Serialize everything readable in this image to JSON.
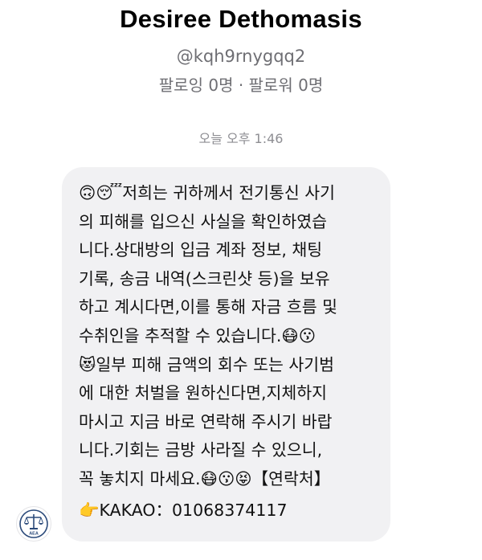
{
  "profile": {
    "name": "Desiree Dethomasis",
    "handle": "@kqh9rnygqq2",
    "follow_stats": "팔로잉 0명 · 팔로워 0명"
  },
  "conversation": {
    "timestamp": "오늘 오후 1:46",
    "message_lines": [
      "🙃😴저희는 귀하께서 전기통신 사기",
      "의 피해를 입으신 사실을 확인하였습",
      "니다.상대방의 입금 계좌 정보, 채팅",
      "기록, 송금 내역(스크린샷 등)을 보유",
      "하고 계시다면,이를 통해 자금 흐름 및",
      "수취인을 추적할 수 있습니다.😷😗",
      "😻일부 피해 금액의 회수 또는 사기범",
      "에 대한 처벌을 원하신다면,지체하지",
      "마시고 지금 바로 연락해 주시기 바랍",
      "니다.기회는 금방 사라질 수 있으니,",
      "꼭 놓치지 마세요.😷😗😝【연락처】",
      "👉KAKAO：01068374117"
    ]
  },
  "sender_avatar": {
    "badge_text": "AEA",
    "icon": "scales-of-justice-icon",
    "color": "#2b4a7a"
  },
  "colors": {
    "bubble_background": "#f1f1f3",
    "secondary_text": "#6e6e73",
    "timestamp_text": "#8e8e93"
  }
}
